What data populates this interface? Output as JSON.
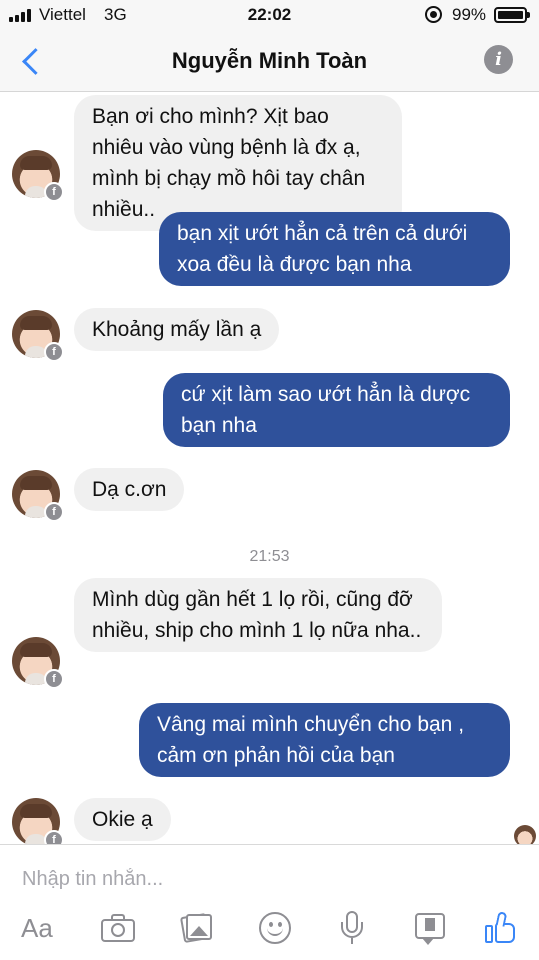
{
  "status_bar": {
    "carrier": "Viettel",
    "network": "3G",
    "time": "22:02",
    "battery": "99%"
  },
  "header": {
    "contact_name": "Nguyễn Minh Toàn",
    "back_icon": "chevron-left-icon",
    "info_icon": "info-icon"
  },
  "messages": [
    {
      "direction": "incoming",
      "text": "Bạn ơi cho mình? Xịt bao nhiêu vào vùng bệnh là đx ạ,  mình bị chạy mồ hôi tay chân nhiều.."
    },
    {
      "direction": "outgoing",
      "text": "bạn xịt ướt hẳn cả trên cả dưới xoa đều là được bạn nha"
    },
    {
      "direction": "incoming",
      "text": "Khoảng mấy lần ạ"
    },
    {
      "direction": "outgoing",
      "text": "cứ xịt làm sao ướt hẳn là dược bạn nha"
    },
    {
      "direction": "incoming",
      "text": "Dạ c.ơn"
    },
    {
      "direction": "incoming",
      "text": "Mình dùg gần hết 1 lọ rồi,  cũng đỡ nhiều, ship cho mình 1 lọ nữa nha.."
    },
    {
      "direction": "outgoing",
      "text": "Vâng mai mình chuyển cho bạn , cảm ơn phản hồi của bạn"
    },
    {
      "direction": "incoming",
      "text": "Okie ạ"
    }
  ],
  "timestamp": "21:53",
  "composer": {
    "placeholder": "Nhập tin nhắn...",
    "aa_label": "Aa",
    "icons": [
      "aa-icon",
      "camera-icon",
      "gallery-icon",
      "emoji-icon",
      "microphone-icon",
      "sticker-icon",
      "like-icon"
    ]
  },
  "colors": {
    "outgoing_bubble": "#2f519b",
    "incoming_bubble": "#f0f0f0",
    "accent": "#3a86f7",
    "icon_gray": "#8e8e93"
  }
}
